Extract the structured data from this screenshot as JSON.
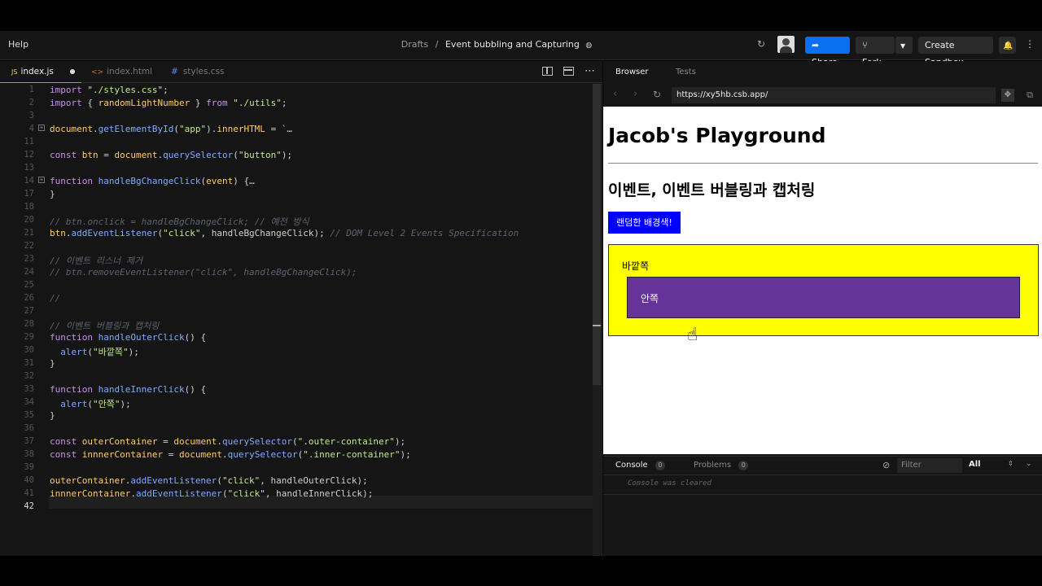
{
  "topbar": {
    "help": "Help",
    "crumb_drafts": "Drafts",
    "crumb_sep": "/",
    "crumb_title": "Event bubbling and Capturing",
    "share": "Share",
    "fork": "Fork",
    "create": "Create Sandbox"
  },
  "tabs": [
    {
      "badge": "JS",
      "label": "index.js"
    },
    {
      "badge": "<>",
      "label": "index.html"
    },
    {
      "badge": "#",
      "label": "styles.css"
    }
  ],
  "code": {
    "lines": [
      {
        "n": "1",
        "text": "import \"./styles.css\";"
      },
      {
        "n": "2",
        "text": "import { randomLightNumber } from \"./utils\";"
      },
      {
        "n": "3",
        "text": ""
      },
      {
        "n": "4",
        "text": "document.getElementById(\"app\").innerHTML = `…"
      },
      {
        "n": "11",
        "text": ""
      },
      {
        "n": "12",
        "text": "const btn = document.querySelector(\"button\");"
      },
      {
        "n": "13",
        "text": ""
      },
      {
        "n": "14",
        "text": "function handleBgChangeClick(event) {…"
      },
      {
        "n": "17",
        "text": "}"
      },
      {
        "n": "18",
        "text": ""
      },
      {
        "n": "20",
        "text": "// btn.onclick = handleBgChangeClick; // 예전 방식"
      },
      {
        "n": "21",
        "text": "btn.addEventListener(\"click\", handleBgChangeClick); // DOM Level 2 Events Specification"
      },
      {
        "n": "22",
        "text": ""
      },
      {
        "n": "23",
        "text": "// 이벤트 리스너 제거"
      },
      {
        "n": "24",
        "text": "// btn.removeEventListener(\"click\", handleBgChangeClick);"
      },
      {
        "n": "25",
        "text": ""
      },
      {
        "n": "26",
        "text": "//"
      },
      {
        "n": "27",
        "text": ""
      },
      {
        "n": "28",
        "text": "// 이벤트 버블링과 캡처링"
      },
      {
        "n": "29",
        "text": "function handleOuterClick() {"
      },
      {
        "n": "30",
        "text": "  alert(\"바깥쪽\");"
      },
      {
        "n": "31",
        "text": "}"
      },
      {
        "n": "32",
        "text": ""
      },
      {
        "n": "33",
        "text": "function handleInnerClick() {"
      },
      {
        "n": "34",
        "text": "  alert(\"안쪽\");"
      },
      {
        "n": "35",
        "text": "}"
      },
      {
        "n": "36",
        "text": ""
      },
      {
        "n": "37",
        "text": "const outerContainer = document.querySelector(\".outer-container\");"
      },
      {
        "n": "38",
        "text": "const innnerContainer = document.querySelector(\".inner-container\");"
      },
      {
        "n": "39",
        "text": ""
      },
      {
        "n": "40",
        "text": "outerContainer.addEventListener(\"click\", handleOuterClick);"
      },
      {
        "n": "41",
        "text": "innnerContainer.addEventListener(\"click\", handleInnerClick);"
      },
      {
        "n": "42",
        "text": ""
      }
    ]
  },
  "browser": {
    "tab_browser": "Browser",
    "tab_tests": "Tests",
    "url": "https://xy5hb.csb.app/"
  },
  "preview": {
    "title": "Jacob's Playground",
    "subtitle": "이벤트, 이벤트 버블링과 캡처링",
    "button": "랜덤한 배경색!",
    "outer": "바깥쪽",
    "inner": "안쪽"
  },
  "console": {
    "tab_console": "Console",
    "console_count": "0",
    "tab_problems": "Problems",
    "problems_count": "0",
    "filter_placeholder": "Filter",
    "level": "All",
    "cleared": "Console was cleared"
  },
  "colors": {
    "accent": "#0971f1",
    "preview_button": "#0000ff",
    "outer_bg": "#ffff00",
    "inner_bg": "#663399"
  }
}
